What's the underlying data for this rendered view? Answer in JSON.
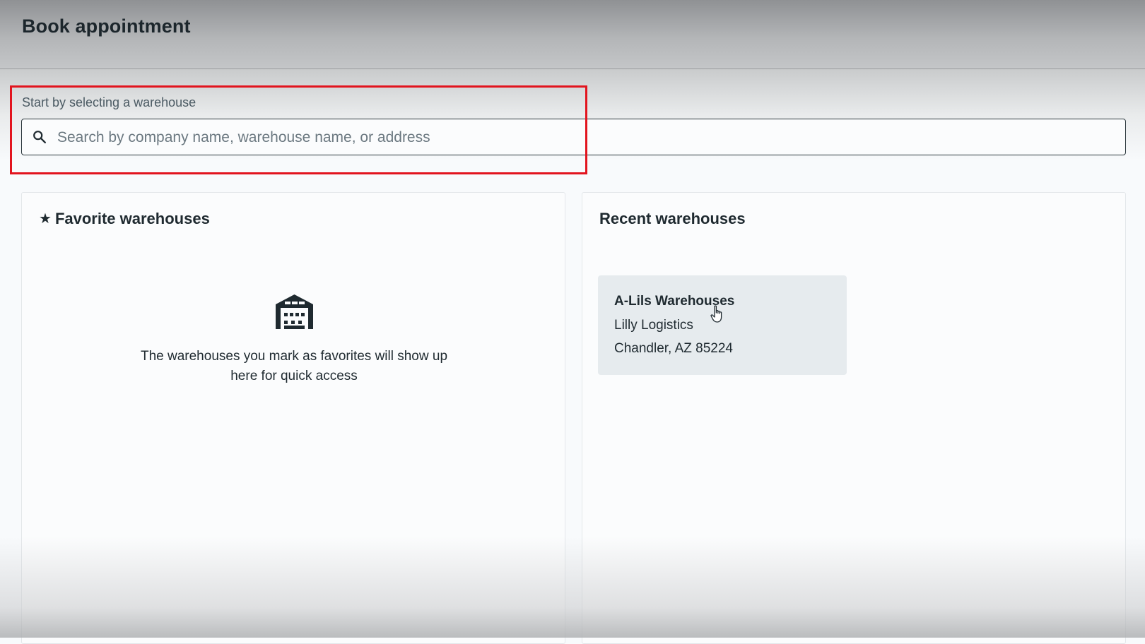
{
  "header": {
    "title": "Book appointment"
  },
  "search": {
    "label": "Start by selecting a warehouse",
    "placeholder": "Search by company name, warehouse name, or address",
    "value": "",
    "icon": "search-icon"
  },
  "favorites": {
    "title": "Favorite warehouses",
    "title_icon": "star-icon",
    "empty_icon": "warehouse-icon",
    "empty_text": "The warehouses you mark as favorites will show up here for quick access"
  },
  "recent": {
    "title": "Recent warehouses",
    "items": [
      {
        "name": "A-Lils Warehouses",
        "company": "Lilly Logistics",
        "address": "Chandler, AZ 85224"
      }
    ]
  },
  "colors": {
    "highlight": "#e2141e",
    "card_background": "#e6ebee",
    "text": "#1f2a30"
  }
}
